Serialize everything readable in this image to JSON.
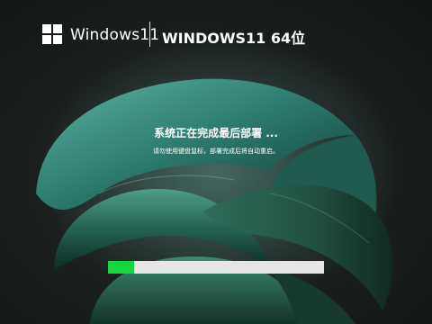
{
  "brand": {
    "logo_icon": "windows-logo-icon",
    "name": "Windows11",
    "edition": "WINDOWS11 64位"
  },
  "status": {
    "message": "系统正在完成最后部署 ...",
    "hint": "请勿使用键盘鼠标，部署完成后将自动重启。"
  },
  "progress": {
    "value": 0.12
  },
  "colors": {
    "background": "#1b201f",
    "wallpaper_accent": "#2f7f72",
    "progress_fill": "#15d63a",
    "progress_track": "#e6e6e4",
    "text": "#ffffff"
  }
}
